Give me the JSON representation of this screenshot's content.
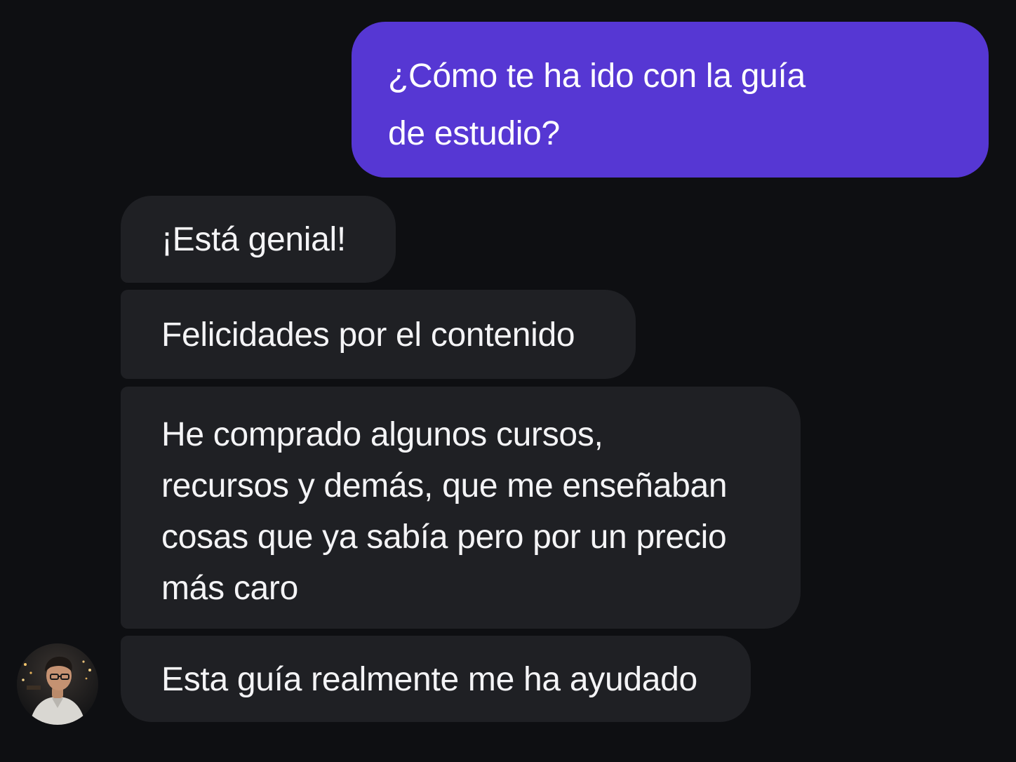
{
  "conversation": {
    "sent": {
      "lines": [
        "¿Cómo te ha ido con la guía",
        "de estudio?"
      ]
    },
    "received": [
      {
        "text": "¡Está genial!"
      },
      {
        "text": "Felicidades por el contenido"
      },
      {
        "lines": [
          "He comprado algunos cursos,",
          "recursos y demás, que me enseñaban",
          "cosas que ya sabía pero por un precio",
          "más caro"
        ]
      },
      {
        "text": "Esta guía realmente me ha ayudado"
      }
    ]
  },
  "colors": {
    "background": "#0e0f12",
    "sent_bubble": "#5637d3",
    "received_bubble": "#1f2024",
    "text": "#f4f4f6"
  },
  "icons": {
    "avatar": "user-avatar-photo"
  }
}
